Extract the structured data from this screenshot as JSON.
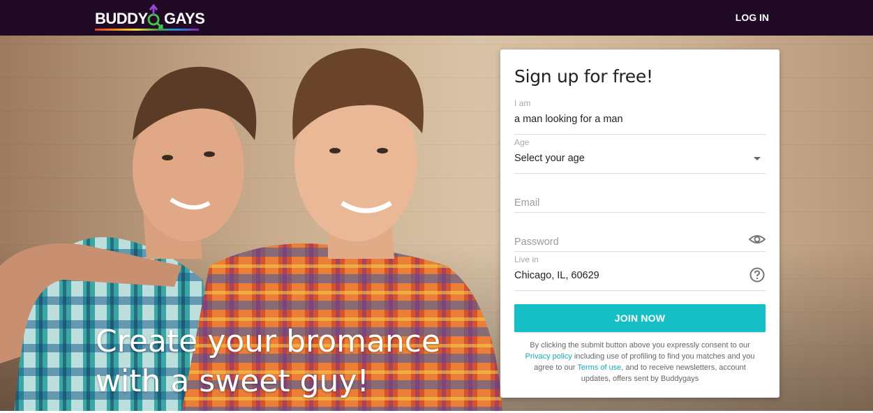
{
  "header": {
    "logo_left": "BUDDY",
    "logo_right": "GAYS",
    "login_label": "LOG IN"
  },
  "hero": {
    "headline_line1": "Create your bromance",
    "headline_line2": "with a sweet guy!"
  },
  "form": {
    "title": "Sign up for free!",
    "iam": {
      "label": "I am",
      "value": "a man looking for a man"
    },
    "age": {
      "label": "Age",
      "value": "Select your age"
    },
    "email": {
      "placeholder": "Email"
    },
    "password": {
      "placeholder": "Password"
    },
    "live_in": {
      "label": "Live in",
      "value": "Chicago, IL, 60629"
    },
    "submit_label": "JOIN NOW",
    "legal": {
      "part1": "By clicking the submit button above you expressly consent to our ",
      "privacy_link": "Privacy policy",
      "part2": " including use of profiling to find you matches and you agree to our ",
      "terms_link": "Terms of use",
      "part3": ", and to receive newsletters, account updates, offers sent by Buddygays"
    }
  },
  "colors": {
    "header_bg": "#200a25",
    "accent": "#16bfc6",
    "link": "#17a9b3"
  },
  "icons": [
    "gender-symbol-logo-icon",
    "eye-icon",
    "help-icon",
    "chevron-down-icon"
  ]
}
